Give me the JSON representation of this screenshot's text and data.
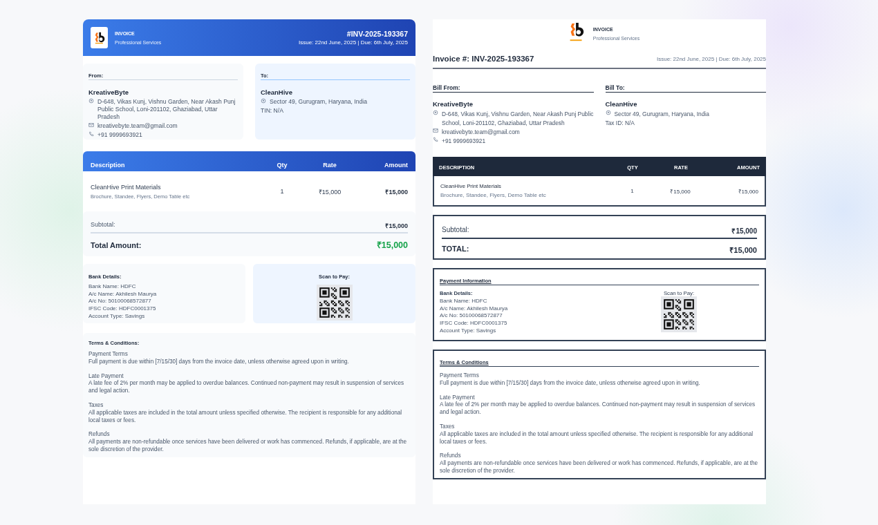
{
  "modern_invoice": {
    "header": {
      "title": "INVOICE",
      "subtitle": "Professional Services",
      "number": "#INV-2025-193367",
      "dates": "Issue: 22nd June, 2025 | Due: 6th July, 2025"
    },
    "from": {
      "label": "From:",
      "name": "KreativeByte",
      "address": "D-648, Vikas Kunj, Vishnu Garden, Near Akash Punj Public School, Loni-201102, Ghaziabad, Uttar Pradesh",
      "email": "kreativebyte.team@gmail.com",
      "phone": "+91 9999693921"
    },
    "to": {
      "label": "To:",
      "name": "CleanHive",
      "address": "Sector 49, Gurugram, Haryana, India",
      "tax": "TIN: N/A"
    },
    "table": {
      "columns": [
        "Description",
        "Qty",
        "Rate",
        "Amount"
      ],
      "rows": [
        {
          "description": "CleanHive Print Materials",
          "detail": "Brochure, Standee, Flyers, Demo Table etc",
          "qty": "1",
          "rate": "₹15,000",
          "amount": "₹15,000"
        }
      ]
    },
    "totals": {
      "subtotal_label": "Subtotal:",
      "subtotal": "₹15,000",
      "total_label": "Total Amount:",
      "total": "₹15,000"
    },
    "bank": {
      "title": "Bank Details:",
      "lines": [
        "Bank Name: HDFC",
        "A/c Name: Akhilesh Maurya",
        "A/c No: 50100068572877",
        "IFSC Code: HDFC0001375",
        "Account Type: Savings"
      ]
    },
    "qr": {
      "label": "Scan to Pay:"
    },
    "terms": {
      "title": "Terms & Conditions:",
      "sections": [
        {
          "heading": "Payment Terms",
          "text": "Full payment is due within [7/15/30] days from the invoice date, unless otherwise agreed upon in writing."
        },
        {
          "heading": "Late Payment",
          "text": "A late fee of 2% per month may be applied to overdue balances. Continued non-payment may result in suspension of services and legal action."
        },
        {
          "heading": "Taxes",
          "text": "All applicable taxes are included in the total amount unless specified otherwise. The recipient is responsible for any additional local taxes or fees."
        },
        {
          "heading": "Refunds",
          "text": "All payments are non-refundable once services have been delivered or work has commenced. Refunds, if applicable, are at the sole discretion of the provider."
        }
      ]
    }
  },
  "classic_invoice": {
    "header": {
      "title": "INVOICE",
      "subtitle": "Professional Services",
      "number": "Invoice #: INV-2025-193367",
      "dates": "Issue: 22nd June, 2025 | Due: 6th July, 2025"
    },
    "from": {
      "label": "Bill From:",
      "name": "KreativeByte",
      "address": "D-648, Vikas Kunj, Vishnu Garden, Near Akash Punj Public School, Loni-201102, Ghaziabad, Uttar Pradesh",
      "email": "kreativebyte.team@gmail.com",
      "phone": "+91 9999693921"
    },
    "to": {
      "label": "Bill To:",
      "name": "CleanHive",
      "address": "Sector 49, Gurugram, Haryana, India",
      "tax": "Tax ID: N/A"
    },
    "table": {
      "columns": [
        "DESCRIPTION",
        "QTY",
        "RATE",
        "AMOUNT"
      ],
      "rows": [
        {
          "description": "CleanHive Print Materials",
          "detail": "Brochure, Standee, Flyers, Demo Table etc",
          "qty": "1",
          "rate": "₹15,000",
          "amount": "₹15,000"
        }
      ]
    },
    "totals": {
      "subtotal_label": "Subtotal:",
      "subtotal": "₹15,000",
      "total_label": "TOTAL:",
      "total": "₹15,000"
    },
    "payment_title": "Payment Information",
    "bank": {
      "title": "Bank Details:",
      "lines": [
        "Bank Name: HDFC",
        "A/c Name: Akhilesh Maurya",
        "A/c No: 50100068572877",
        "IFSC Code: HDFC0001375",
        "Account Type: Savings"
      ]
    },
    "qr": {
      "label": "Scan to Pay:"
    },
    "terms": {
      "title": "Terms & Conditions",
      "sections": [
        {
          "heading": "Payment Terms",
          "text": "Full payment is due within [7/15/30] days from the invoice date, unless otherwise agreed upon in writing."
        },
        {
          "heading": "Late Payment",
          "text": "A late fee of 2% per month may be applied to overdue balances. Continued non-payment may result in suspension of services and legal action."
        },
        {
          "heading": "Taxes",
          "text": "All applicable taxes are included in the total amount unless specified otherwise. The recipient is responsible for any additional local taxes or fees."
        },
        {
          "heading": "Refunds",
          "text": "All payments are non-refundable once services have been delivered or work has commenced. Refunds, if applicable, are at the sole discretion of the provider."
        }
      ]
    }
  }
}
